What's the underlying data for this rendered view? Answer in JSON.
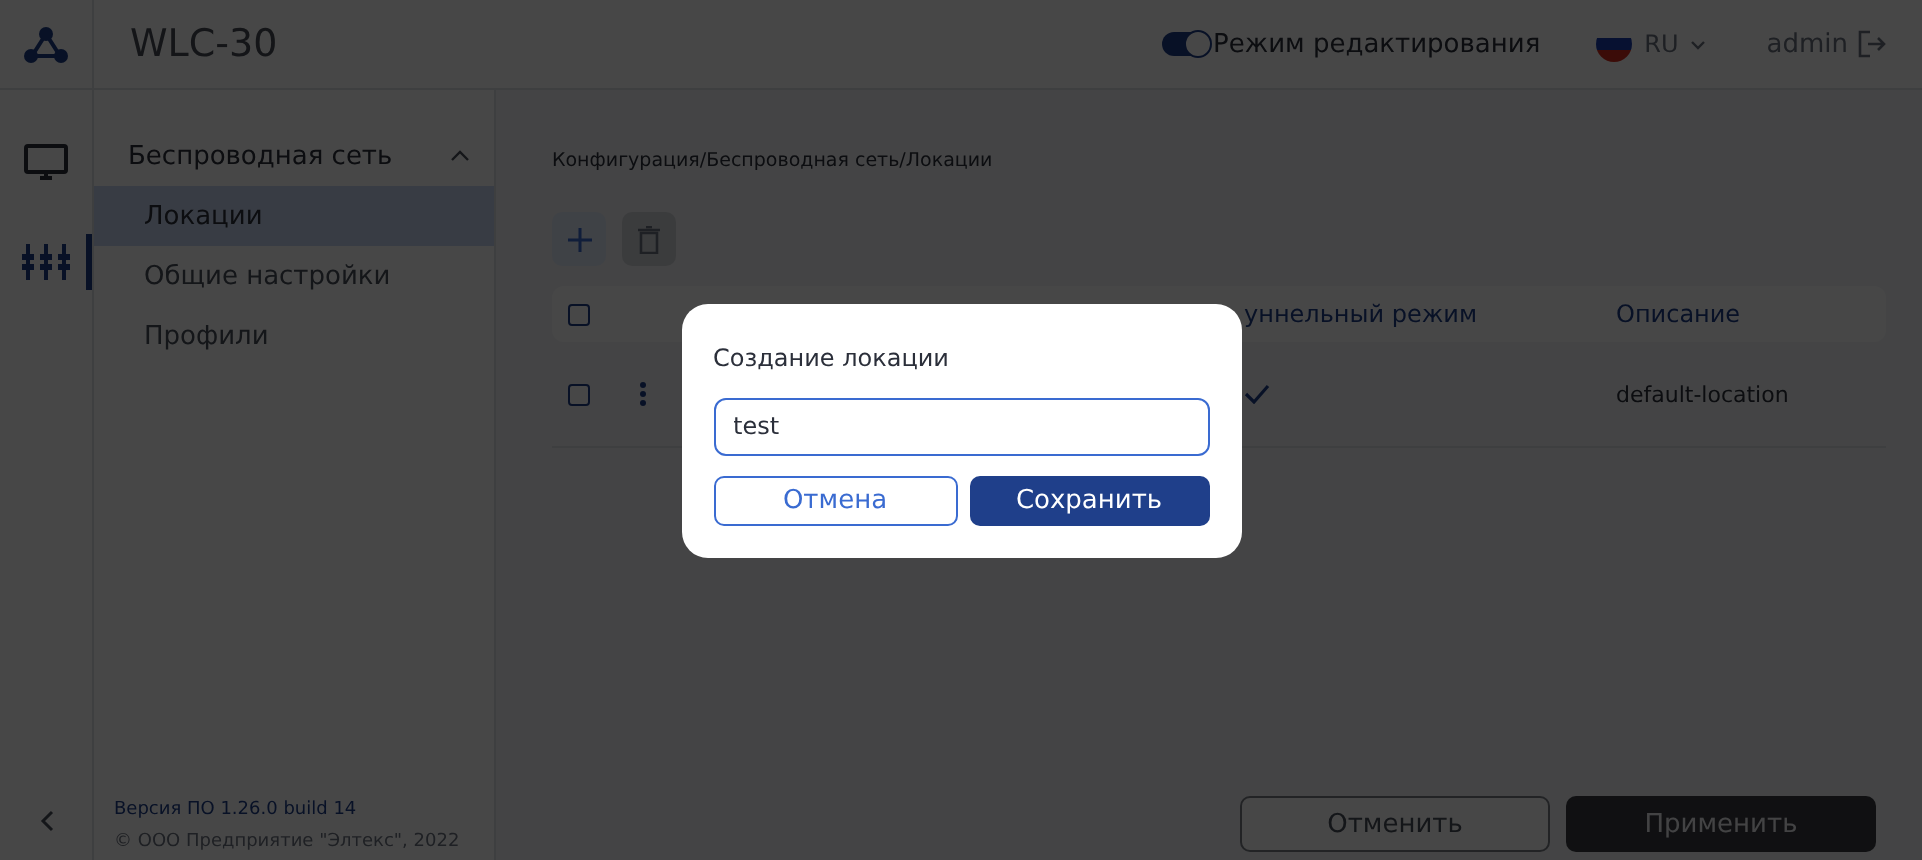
{
  "header": {
    "title": "WLC-30",
    "edit_mode": {
      "label": "Режим редактирования",
      "on": true
    },
    "language": "RU",
    "user": "admin"
  },
  "rail": [
    {
      "kind": "monitor",
      "selected": false
    },
    {
      "kind": "network",
      "selected": true
    }
  ],
  "sidebar": {
    "group": {
      "label": "Беспроводная сеть",
      "expanded": true
    },
    "items": [
      {
        "label": "Локации",
        "selected": true
      },
      {
        "label": "Общие настройки",
        "selected": false
      },
      {
        "label": "Профили",
        "selected": false
      }
    ],
    "version": "Версия ПО 1.26.0 build 14",
    "copyright": "© ООО Предприятие \"Элтекс\", 2022"
  },
  "breadcrumb": "Конфигурация/Беспроводная сеть/Локации",
  "table": {
    "all_checked": false,
    "columns": [
      "уннельный режим",
      "Описание"
    ],
    "rows": [
      {
        "checked": false,
        "tunnel": true,
        "description": "default-location"
      }
    ]
  },
  "dialog": {
    "title": "Создание локации",
    "value": "test",
    "buttons": [
      "Отмена",
      "Сохранить"
    ]
  },
  "footer": {
    "buttons": [
      "Отменить",
      "Применить"
    ]
  }
}
